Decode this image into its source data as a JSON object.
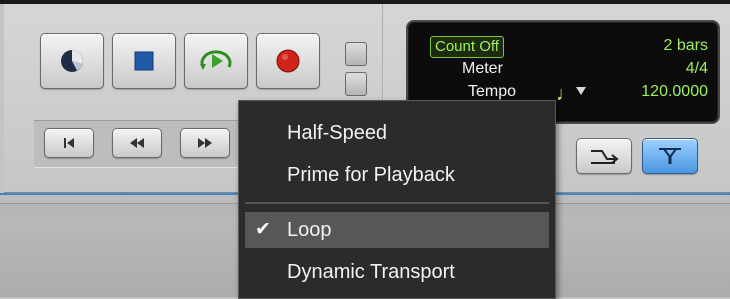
{
  "transport": {
    "buttons": [
      {
        "name": "online-button",
        "icon": "online-clock-icon"
      },
      {
        "name": "stop-button",
        "icon": "stop-icon"
      },
      {
        "name": "play-button",
        "icon": "play-icon"
      },
      {
        "name": "record-button",
        "icon": "record-icon"
      }
    ],
    "nav_buttons": [
      {
        "name": "return-to-zero-button",
        "icon": "return-to-zero-icon"
      },
      {
        "name": "rewind-button",
        "icon": "rewind-icon"
      },
      {
        "name": "fast-forward-button",
        "icon": "fast-forward-icon"
      }
    ],
    "colors": {
      "stop": "#1f5aa8",
      "play": "#3aa32b",
      "record": "#d0241a"
    }
  },
  "counter": {
    "count_off_label": "Count Off",
    "count_off_value": "2 bars",
    "meter_label": "Meter",
    "meter_value": "4/4",
    "tempo_label": "Tempo",
    "tempo_value": "120.0000",
    "note_glyph": "♩"
  },
  "right_buttons": [
    {
      "name": "merge-button",
      "icon": "merge-arrow-icon"
    },
    {
      "name": "midi-input-button",
      "icon": "midi-input-icon",
      "active": true
    }
  ],
  "context_menu": {
    "items": [
      {
        "label": "Half-Speed",
        "checked": false
      },
      {
        "label": "Prime for Playback",
        "checked": false
      },
      {
        "label": "Loop",
        "checked": true
      },
      {
        "label": "Dynamic Transport",
        "checked": false
      }
    ],
    "check_glyph": "✔"
  }
}
